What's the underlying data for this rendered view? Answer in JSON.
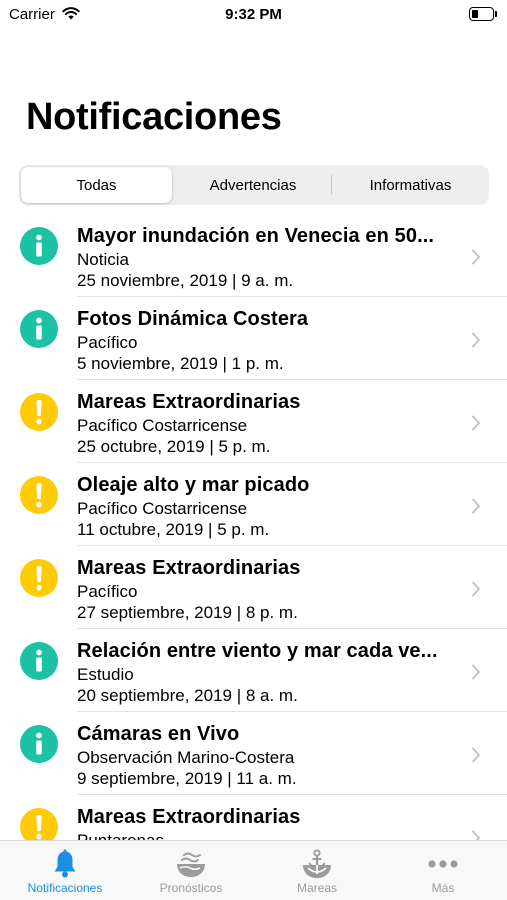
{
  "status_bar": {
    "carrier": "Carrier",
    "time": "9:32 PM"
  },
  "page": {
    "title": "Notificaciones"
  },
  "segments": [
    {
      "label": "Todas",
      "selected": true
    },
    {
      "label": "Advertencias",
      "selected": false
    },
    {
      "label": "Informativas",
      "selected": false
    }
  ],
  "notifications": [
    {
      "type": "info",
      "icon": "info-icon",
      "title": "Mayor inundación en Venecia en 50...",
      "subtitle": "Noticia",
      "date": "25 noviembre, 2019 | 9 a. m."
    },
    {
      "type": "info",
      "icon": "info-icon",
      "title": "Fotos Dinámica Costera",
      "subtitle": "Pacífico",
      "date": "5 noviembre, 2019 | 1 p. m."
    },
    {
      "type": "warning",
      "icon": "exclamation-icon",
      "title": "Mareas Extraordinarias",
      "subtitle": "Pacífico Costarricense",
      "date": "25 octubre, 2019 | 5 p. m."
    },
    {
      "type": "warning",
      "icon": "exclamation-icon",
      "title": "Oleaje alto y mar picado",
      "subtitle": "Pacífico Costarricense",
      "date": "11 octubre, 2019 | 5 p. m."
    },
    {
      "type": "warning",
      "icon": "exclamation-icon",
      "title": "Mareas Extraordinarias",
      "subtitle": "Pacífico",
      "date": "27 septiembre, 2019 | 8 p. m."
    },
    {
      "type": "info",
      "icon": "info-icon",
      "title": "Relación entre viento y mar cada ve...",
      "subtitle": "Estudio",
      "date": "20 septiembre, 2019 | 8 a. m."
    },
    {
      "type": "info",
      "icon": "info-icon",
      "title": "Cámaras en Vivo",
      "subtitle": "Observación Marino-Costera",
      "date": "9 septiembre, 2019 | 11 a. m."
    },
    {
      "type": "warning",
      "icon": "exclamation-icon",
      "title": "Mareas Extraordinarias",
      "subtitle": "Puntarenas",
      "date": ""
    }
  ],
  "tab_bar": [
    {
      "label": "Notificaciones",
      "icon": "bell-icon",
      "active": true
    },
    {
      "label": "Pronósticos",
      "icon": "weather-bowl-icon",
      "active": false
    },
    {
      "label": "Mareas",
      "icon": "anchor-icon",
      "active": false
    },
    {
      "label": "Más",
      "icon": "more-dots-icon",
      "active": false
    }
  ],
  "colors": {
    "info": "#1cc2a4",
    "warning": "#ffcb05",
    "accent": "#1a8fe3",
    "inactive": "#9b9b9b"
  }
}
